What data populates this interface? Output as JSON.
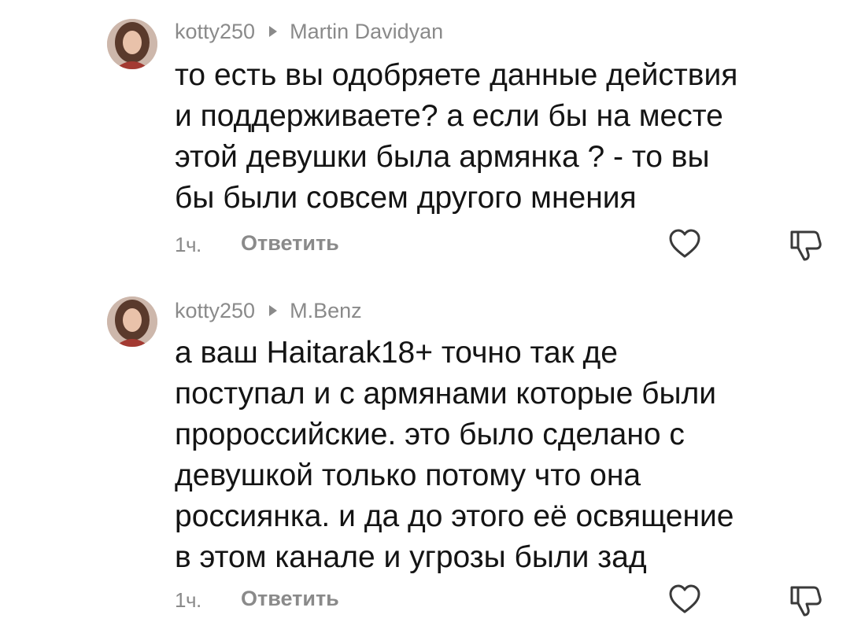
{
  "comments": [
    {
      "author": "kotty250",
      "reply_to": "Martin Davidyan",
      "lines": [
        "то есть вы одобряете данные действия",
        "и поддерживаете? а если бы на месте",
        "этой девушки была армянка ? - то вы",
        "бы были совсем другого мнения"
      ],
      "time": "1ч.",
      "reply_label": "Ответить",
      "like_icon": "heart-outline-icon",
      "dislike_icon": "thumbs-down-outline-icon"
    },
    {
      "author": "kotty250",
      "reply_to": "M.Benz",
      "lines": [
        "а ваш Haitarak18+ точно так де",
        "поступал и с армянами которые были",
        "пророссийские. это было сделано с",
        "девушкой только потому что она",
        "россиянка. и да до этого её освящение",
        "в этом канале и угрозы были зад"
      ],
      "time": "1ч.",
      "reply_label": "Ответить",
      "like_icon": "heart-outline-icon",
      "dislike_icon": "thumbs-down-outline-icon"
    }
  ],
  "colors": {
    "text": "#141414",
    "secondary": "#8a8a8a",
    "background": "#ffffff"
  }
}
